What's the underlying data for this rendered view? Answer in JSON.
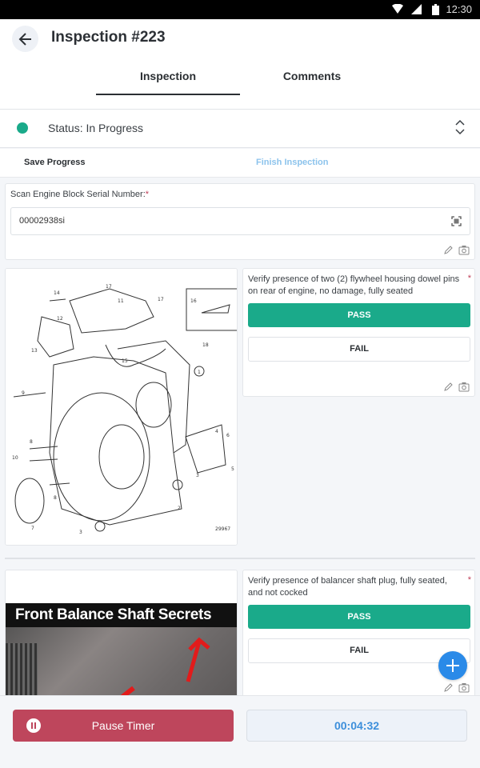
{
  "status_bar": {
    "time": "12:30",
    "icons": [
      "wifi-icon",
      "signal-icon",
      "battery-icon"
    ]
  },
  "header": {
    "title": "Inspection #223",
    "back_icon": "arrow-left-icon"
  },
  "tabs": [
    {
      "label": "Inspection",
      "active": true
    },
    {
      "label": "Comments",
      "active": false
    }
  ],
  "status": {
    "label": "Status: In Progress",
    "color": "#1aaa8a"
  },
  "actions": {
    "save": "Save Progress",
    "finish": "Finish Inspection"
  },
  "serial_field": {
    "label": "Scan Engine Block Serial Number:",
    "required_mark": "*",
    "value": "00002938si"
  },
  "diagram": {
    "part_labels": [
      "1",
      "2",
      "3",
      "3",
      "4",
      "5",
      "6",
      "7",
      "8",
      "8",
      "9",
      "10",
      "11",
      "12",
      "13",
      "14",
      "15",
      "16",
      "17",
      "17",
      "18"
    ],
    "figure_number": "29967"
  },
  "video_thumbnail": {
    "caption": "Front Balance Shaft Secrets"
  },
  "questions": [
    {
      "text": "Verify presence of two (2) flywheel housing dowel pins on rear of engine, no damage, fully seated",
      "required_mark": "*",
      "pass_label": "PASS",
      "fail_label": "FAIL",
      "selected": "PASS"
    },
    {
      "text": "Verify presence of balancer shaft plug, fully seated, and not cocked",
      "required_mark": "*",
      "pass_label": "PASS",
      "fail_label": "FAIL",
      "selected": "PASS"
    }
  ],
  "footer": {
    "pause_label": "Pause Timer",
    "timer": "00:04:32"
  },
  "colors": {
    "accent_green": "#1aaa8a",
    "pause_red": "#be465c",
    "timer_blue": "#3d8fdb",
    "fab_blue": "#2a8ae8"
  }
}
